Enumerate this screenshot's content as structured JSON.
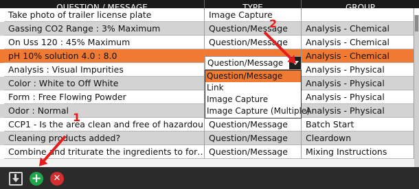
{
  "columns": [
    "QUESTION / MESSAGE",
    "TYPE",
    "GROUP"
  ],
  "rows": [
    {
      "question": "Take photo of trailer license plate",
      "type": "Image Capture",
      "group": "",
      "bg": "#ffffff"
    },
    {
      "question": "Gassing CO2 Range : 3% Maximum",
      "type": "Question/Message",
      "group": "Analysis - Chemical",
      "bg": "#d3d3d3"
    },
    {
      "question": "On Uss 120 : 45% Maximum",
      "type": "Question/Message",
      "group": "Analysis - Chemical",
      "bg": "#ffffff"
    },
    {
      "question": "pH 10% solution 4.0 : 8.0",
      "type": "",
      "group": "Analysis - Chemical",
      "bg": "#f07a32"
    },
    {
      "question": "Analysis : Visual Impurities",
      "type": "",
      "group": "Analysis - Physical",
      "bg": "#ffffff"
    },
    {
      "question": "Color : White to Off White",
      "type": "",
      "group": "Analysis - Physical",
      "bg": "#d3d3d3"
    },
    {
      "question": "Form : Free Flowing Powder",
      "type": "",
      "group": "Analysis - Physical",
      "bg": "#ffffff"
    },
    {
      "question": "Odor : Normal",
      "type": "",
      "group": "Analysis - Physical",
      "bg": "#d3d3d3"
    },
    {
      "question": "CCP1 - Is the area clean and free of hazardou…",
      "type": "Question/Message",
      "group": "Batch Start",
      "bg": "#ffffff"
    },
    {
      "question": "Cleaning products added?",
      "type": "Question/Message",
      "group": "Cleardown",
      "bg": "#d3d3d3"
    },
    {
      "question": "Combine and triturate the ingredients to for…",
      "type": "Question/Message",
      "group": "Mixing Instructions",
      "bg": "#ffffff"
    }
  ],
  "editor": {
    "value": "Question/Message"
  },
  "dropdown": {
    "options": [
      "Question/Message",
      "Link",
      "Image Capture",
      "Image Capture (Multiple)"
    ],
    "selected_index": 0,
    "selected_bg": "#f07a32"
  },
  "footer": {
    "add_glyph": "+",
    "delete_glyph": "✕"
  },
  "annotations": {
    "label_1": "1",
    "label_2": "2",
    "color": "#e51c1c"
  },
  "colors": {
    "header_bg": "#1a1a1a",
    "highlight": "#f07a32",
    "alt_row": "#d3d3d3"
  }
}
